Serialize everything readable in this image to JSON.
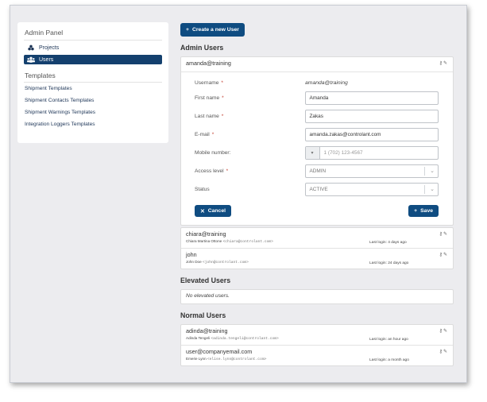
{
  "sidebar": {
    "admin_panel": "Admin Panel",
    "items": [
      {
        "label": "Projects",
        "icon": "projects-icon"
      },
      {
        "label": "Users",
        "icon": "users-icon"
      }
    ],
    "templates_heading": "Templates",
    "templates": [
      "Shipment Templates",
      "Shipment Contacts Templates",
      "Shipment Warnings Templates",
      "Integration Loggers Templates"
    ]
  },
  "toolbar": {
    "create_label": "Create a new User"
  },
  "admin_users": {
    "title": "Admin Users",
    "editing": {
      "header": "amanda@training",
      "username_label": "Username",
      "username_value": "amanda@training",
      "first_name_label": "First name",
      "first_name_value": "Amanda",
      "last_name_label": "Last name",
      "last_name_value": "Zakas",
      "email_label": "E-mail",
      "email_value": "amanda.zakas@controlant.com",
      "mobile_label": "Mobile number:",
      "mobile_placeholder": "1 (702) 123-4567",
      "access_label": "Access level",
      "access_value": "ADMIN",
      "status_label": "Status",
      "status_value": "ACTIVE",
      "cancel_label": "Cancel",
      "save_label": "Save"
    },
    "rows": [
      {
        "name": "chiara@training",
        "full_name": "Chiara Martina Ottone",
        "email": "<chiara@controlant.com>",
        "last_login": "Last login: 4 days ago"
      },
      {
        "name": "john",
        "full_name": "John Doe",
        "email": "<john@controlant.com>",
        "last_login": "Last login: 24 days ago"
      }
    ]
  },
  "elevated_users": {
    "title": "Elevated Users",
    "empty": "No elevated users."
  },
  "normal_users": {
    "title": "Normal Users",
    "rows": [
      {
        "name": "adinda@training",
        "full_name": "Adinda Tengeli",
        "email": "<adinda.tengeli@controlant.com>",
        "last_login": "Last login: an hour ago"
      },
      {
        "name": "user@companyemail.com",
        "full_name": "Emerie Lynn",
        "email": "<elise.lynn@controlant.com>",
        "last_login": "Last login: a month ago"
      }
    ]
  },
  "colors": {
    "primary": "#0f4c81",
    "sidebar_active": "#14406e",
    "background": "#ececef"
  }
}
